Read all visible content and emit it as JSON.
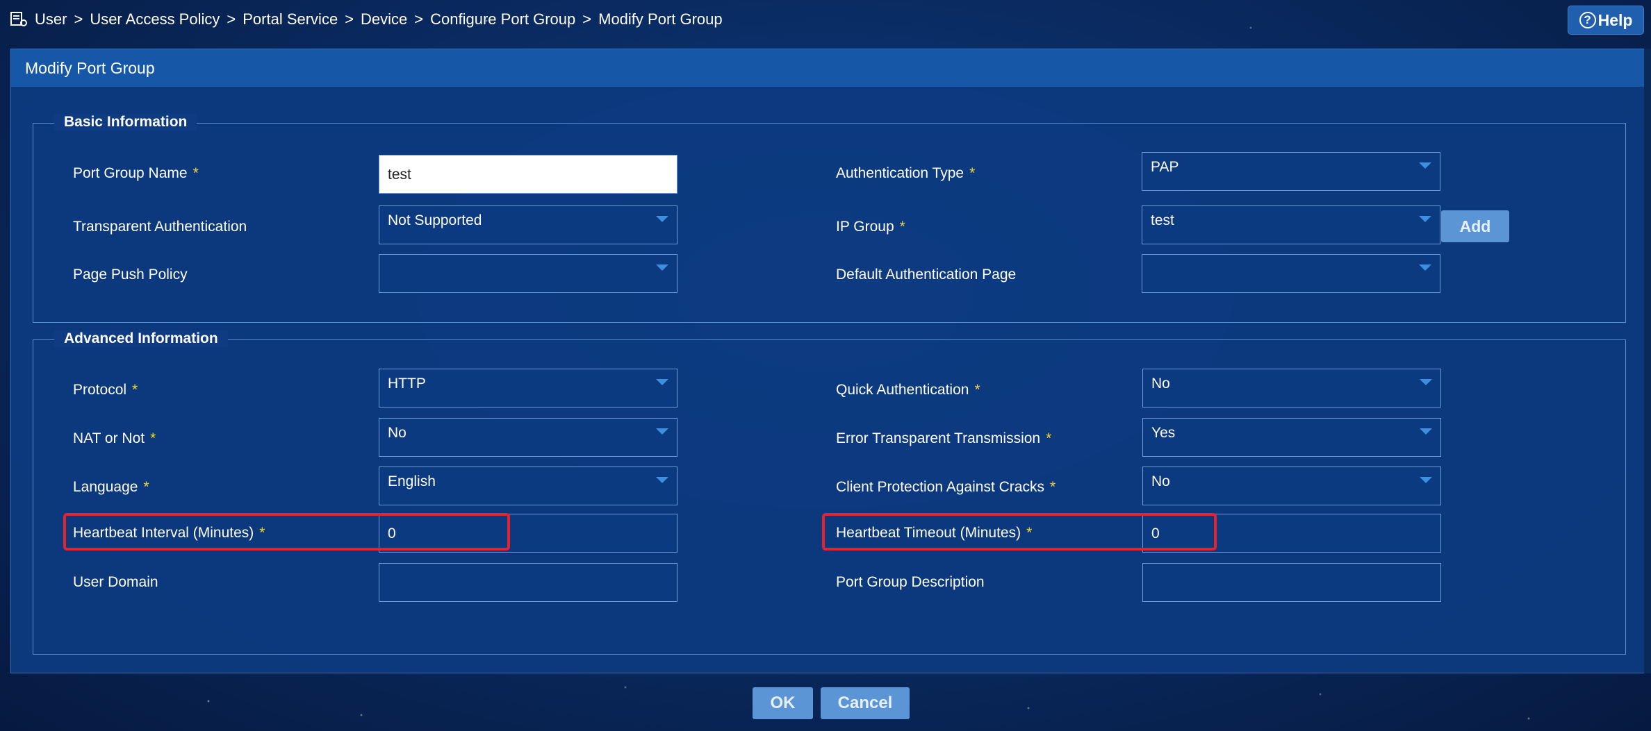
{
  "breadcrumb": {
    "items": [
      "User",
      "User Access Policy",
      "Portal Service",
      "Device",
      "Configure Port Group",
      "Modify Port Group"
    ],
    "separator": ">"
  },
  "help": {
    "label": "Help",
    "icon": "question-circle-icon"
  },
  "panel": {
    "title": "Modify Port Group"
  },
  "basic": {
    "legend": "Basic Information",
    "port_group_name": {
      "label": "Port Group Name",
      "required": "*",
      "value": "test"
    },
    "authentication_type": {
      "label": "Authentication Type",
      "required": "*",
      "value": "PAP"
    },
    "transparent_authentication": {
      "label": "Transparent Authentication",
      "value": "Not Supported"
    },
    "ip_group": {
      "label": "IP Group",
      "required": "*",
      "value": "test",
      "add_label": "Add"
    },
    "page_push_policy": {
      "label": "Page Push Policy",
      "value": ""
    },
    "default_authentication_page": {
      "label": "Default Authentication Page",
      "value": ""
    }
  },
  "advanced": {
    "legend": "Advanced Information",
    "protocol": {
      "label": "Protocol",
      "required": "*",
      "value": "HTTP"
    },
    "quick_authentication": {
      "label": "Quick Authentication",
      "required": "*",
      "value": "No"
    },
    "nat": {
      "label": "NAT or Not",
      "required": "*",
      "value": "No"
    },
    "error_transparent": {
      "label": "Error Transparent Transmission",
      "required": "*",
      "value": "Yes"
    },
    "language": {
      "label": "Language",
      "required": "*",
      "value": "English"
    },
    "client_protection": {
      "label": "Client Protection Against Cracks",
      "required": "*",
      "value": "No"
    },
    "heartbeat_interval": {
      "label": "Heartbeat Interval (Minutes)",
      "required": "*",
      "value": "0"
    },
    "heartbeat_timeout": {
      "label": "Heartbeat Timeout (Minutes)",
      "required": "*",
      "value": "0"
    },
    "user_domain": {
      "label": "User Domain",
      "value": ""
    },
    "port_group_description": {
      "label": "Port Group Description",
      "value": ""
    }
  },
  "footer": {
    "ok": "OK",
    "cancel": "Cancel"
  },
  "colors": {
    "accent": "#1657a8",
    "required": "#f3d148",
    "highlight": "#e4232b",
    "button": "#5b95d6"
  }
}
